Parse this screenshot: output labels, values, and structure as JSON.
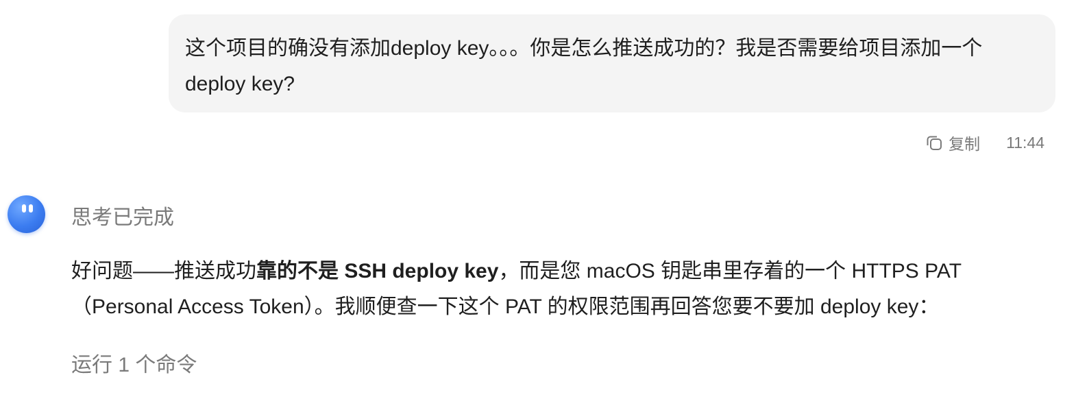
{
  "user_message": {
    "line1": "这个项目的确没有添加deploy key。。。你是怎么推送成功的？我是否需要给项目添加一个",
    "line2": "deploy key?"
  },
  "message_meta": {
    "copy_icon": "copy-icon",
    "copy_label": "复制",
    "time": "11:44"
  },
  "assistant": {
    "avatar_icon": "assistant-avatar",
    "thinking_label": "思考已完成",
    "answer": {
      "part1": "好问题——推送成功",
      "bold": "靠的不是 SSH deploy key",
      "part2": "，而是您 macOS 钥匙串里存着的一个 HTTPS PAT",
      "line2": "（Personal Access Token）。我顺便查一下这个 PAT 的权限范围再回答您要不要加 deploy key："
    },
    "run_command_label": "运行 1 个命令"
  },
  "colors": {
    "bubble_bg": "#f4f4f4",
    "muted_text": "#7a7a7a",
    "avatar_blue": "#3b7cf0"
  }
}
